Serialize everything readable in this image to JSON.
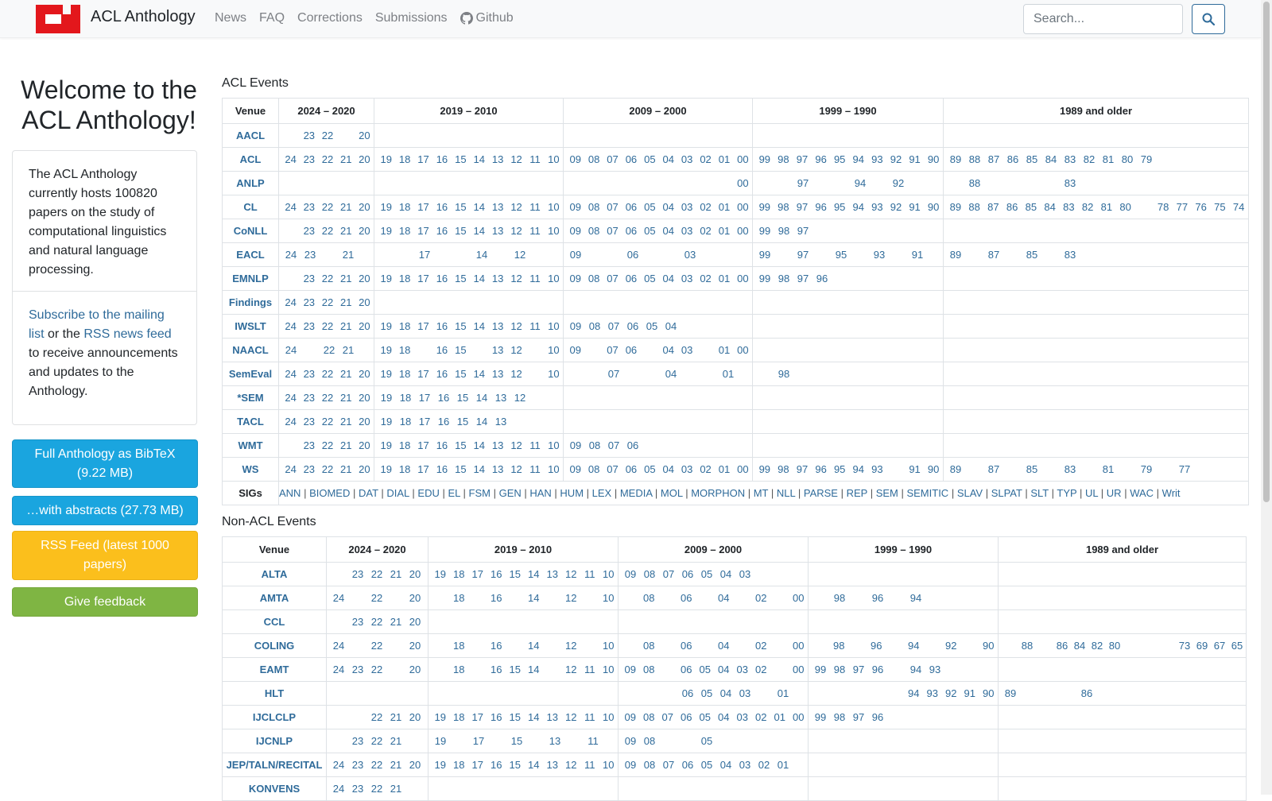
{
  "navbar": {
    "brand": "ACL Anthology",
    "links": [
      "News",
      "FAQ",
      "Corrections",
      "Submissions",
      "Github"
    ],
    "search_placeholder": "Search..."
  },
  "sidebar": {
    "welcome": "Welcome to the ACL Anthology!",
    "intro": "The ACL Anthology currently hosts 100820 papers on the study of computational linguistics and natural language processing.",
    "subscribe_link": "Subscribe to the mailing list",
    "or_the": " or the ",
    "rss_link": "RSS news feed",
    "subscribe_rest": " to receive announcements and updates to the Anthology.",
    "btn_bibtex": "Full Anthology as BibTeX (9.22 MB)",
    "btn_abstracts": "…with abstracts (27.73 MB)",
    "btn_rss": "RSS Feed (latest 1000 papers)",
    "btn_feedback": "Give feedback"
  },
  "acl_events": {
    "title": "ACL Events",
    "headers": [
      "Venue",
      "2024 – 2020",
      "2019 – 2010",
      "2009 – 2000",
      "1999 – 1990",
      "1989 and older"
    ],
    "rows": [
      {
        "venue": "AACL",
        "years": [
          [
            "",
            "23",
            "22",
            "",
            "20"
          ],
          [],
          [],
          [],
          []
        ]
      },
      {
        "venue": "ACL",
        "years": [
          [
            "24",
            "23",
            "22",
            "21",
            "20"
          ],
          [
            "19",
            "18",
            "17",
            "16",
            "15",
            "14",
            "13",
            "12",
            "11",
            "10"
          ],
          [
            "09",
            "08",
            "07",
            "06",
            "05",
            "04",
            "03",
            "02",
            "01",
            "00"
          ],
          [
            "99",
            "98",
            "97",
            "96",
            "95",
            "94",
            "93",
            "92",
            "91",
            "90"
          ],
          [
            "89",
            "88",
            "87",
            "86",
            "85",
            "84",
            "83",
            "82",
            "81",
            "80",
            "79"
          ]
        ]
      },
      {
        "venue": "ANLP",
        "years": [
          [],
          [],
          [
            "",
            "",
            "",
            "",
            "",
            "",
            "",
            "",
            "",
            "00"
          ],
          [
            "",
            "",
            "97",
            "",
            "",
            "94",
            "",
            "92"
          ],
          [
            "",
            "88",
            "",
            "",
            "",
            "",
            "83"
          ]
        ]
      },
      {
        "venue": "CL",
        "years": [
          [
            "24",
            "23",
            "22",
            "21",
            "20"
          ],
          [
            "19",
            "18",
            "17",
            "16",
            "15",
            "14",
            "13",
            "12",
            "11",
            "10"
          ],
          [
            "09",
            "08",
            "07",
            "06",
            "05",
            "04",
            "03",
            "02",
            "01",
            "00"
          ],
          [
            "99",
            "98",
            "97",
            "96",
            "95",
            "94",
            "93",
            "92",
            "91",
            "90"
          ],
          [
            "89",
            "88",
            "87",
            "86",
            "85",
            "84",
            "83",
            "82",
            "81",
            "80",
            "",
            "78",
            "77",
            "76",
            "75",
            "74"
          ]
        ]
      },
      {
        "venue": "CoNLL",
        "years": [
          [
            "",
            "23",
            "22",
            "21",
            "20"
          ],
          [
            "19",
            "18",
            "17",
            "16",
            "15",
            "14",
            "13",
            "12",
            "11",
            "10"
          ],
          [
            "09",
            "08",
            "07",
            "06",
            "05",
            "04",
            "03",
            "02",
            "01",
            "00"
          ],
          [
            "99",
            "98",
            "97"
          ],
          []
        ]
      },
      {
        "venue": "EACL",
        "years": [
          [
            "24",
            "23",
            "",
            "21"
          ],
          [
            "",
            "",
            "17",
            "",
            "",
            "14",
            "",
            "12"
          ],
          [
            "09",
            "",
            "",
            "06",
            "",
            "",
            "03"
          ],
          [
            "99",
            "",
            "97",
            "",
            "95",
            "",
            "93",
            "",
            "91"
          ],
          [
            "89",
            "",
            "87",
            "",
            "85",
            "",
            "83"
          ]
        ]
      },
      {
        "venue": "EMNLP",
        "years": [
          [
            "",
            "23",
            "22",
            "21",
            "20"
          ],
          [
            "19",
            "18",
            "17",
            "16",
            "15",
            "14",
            "13",
            "12",
            "11",
            "10"
          ],
          [
            "09",
            "08",
            "07",
            "06",
            "05",
            "04",
            "03",
            "02",
            "01",
            "00"
          ],
          [
            "99",
            "98",
            "97",
            "96"
          ],
          []
        ]
      },
      {
        "venue": "Findings",
        "years": [
          [
            "24",
            "23",
            "22",
            "21",
            "20"
          ],
          [],
          [],
          [],
          []
        ]
      },
      {
        "venue": "IWSLT",
        "years": [
          [
            "24",
            "23",
            "22",
            "21",
            "20"
          ],
          [
            "19",
            "18",
            "17",
            "16",
            "15",
            "14",
            "13",
            "12",
            "11",
            "10"
          ],
          [
            "09",
            "08",
            "07",
            "06",
            "05",
            "04"
          ],
          [],
          []
        ]
      },
      {
        "venue": "NAACL",
        "years": [
          [
            "24",
            "",
            "22",
            "21"
          ],
          [
            "19",
            "18",
            "",
            "16",
            "15",
            "",
            "13",
            "12",
            "",
            "10"
          ],
          [
            "09",
            "",
            "07",
            "06",
            "",
            "04",
            "03",
            "",
            "01",
            "00"
          ],
          [],
          []
        ]
      },
      {
        "venue": "SemEval",
        "years": [
          [
            "24",
            "23",
            "22",
            "21",
            "20"
          ],
          [
            "19",
            "18",
            "17",
            "16",
            "15",
            "14",
            "13",
            "12",
            "",
            "10"
          ],
          [
            "",
            "",
            "07",
            "",
            "",
            "04",
            "",
            "",
            "01"
          ],
          [
            "",
            "98"
          ],
          []
        ]
      },
      {
        "venue": "*SEM",
        "years": [
          [
            "24",
            "23",
            "22",
            "21",
            "20"
          ],
          [
            "19",
            "18",
            "17",
            "16",
            "15",
            "14",
            "13",
            "12"
          ],
          [],
          [],
          []
        ]
      },
      {
        "venue": "TACL",
        "years": [
          [
            "24",
            "23",
            "22",
            "21",
            "20"
          ],
          [
            "19",
            "18",
            "17",
            "16",
            "15",
            "14",
            "13"
          ],
          [],
          [],
          []
        ]
      },
      {
        "venue": "WMT",
        "years": [
          [
            "",
            "23",
            "22",
            "21",
            "20"
          ],
          [
            "19",
            "18",
            "17",
            "16",
            "15",
            "14",
            "13",
            "12",
            "11",
            "10"
          ],
          [
            "09",
            "08",
            "07",
            "06"
          ],
          [],
          []
        ]
      },
      {
        "venue": "WS",
        "years": [
          [
            "24",
            "23",
            "22",
            "21",
            "20"
          ],
          [
            "19",
            "18",
            "17",
            "16",
            "15",
            "14",
            "13",
            "12",
            "11",
            "10"
          ],
          [
            "09",
            "08",
            "07",
            "06",
            "05",
            "04",
            "03",
            "02",
            "01",
            "00"
          ],
          [
            "99",
            "98",
            "97",
            "96",
            "95",
            "94",
            "93",
            "",
            "91",
            "90"
          ],
          [
            "89",
            "",
            "87",
            "",
            "85",
            "",
            "83",
            "",
            "81",
            "",
            "79",
            "",
            "77"
          ]
        ]
      }
    ],
    "sigs_label": "SIGs",
    "sigs": [
      "ANN",
      "BIOMED",
      "DAT",
      "DIAL",
      "EDU",
      "EL",
      "FSM",
      "GEN",
      "HAN",
      "HUM",
      "LEX",
      "MEDIA",
      "MOL",
      "MORPHON",
      "MT",
      "NLL",
      "PARSE",
      "REP",
      "SEM",
      "SEMITIC",
      "SLAV",
      "SLPAT",
      "SLT",
      "TYP",
      "UL",
      "UR",
      "WAC",
      "Writ"
    ]
  },
  "non_acl_events": {
    "title": "Non-ACL Events",
    "headers": [
      "Venue",
      "2024 – 2020",
      "2019 – 2010",
      "2009 – 2000",
      "1999 – 1990",
      "1989 and older"
    ],
    "rows": [
      {
        "venue": "ALTA",
        "years": [
          [
            "",
            "23",
            "22",
            "21",
            "20"
          ],
          [
            "19",
            "18",
            "17",
            "16",
            "15",
            "14",
            "13",
            "12",
            "11",
            "10"
          ],
          [
            "09",
            "08",
            "07",
            "06",
            "05",
            "04",
            "03"
          ],
          [],
          []
        ]
      },
      {
        "venue": "AMTA",
        "years": [
          [
            "24",
            "",
            "22",
            "",
            "20"
          ],
          [
            "",
            "18",
            "",
            "16",
            "",
            "14",
            "",
            "12",
            "",
            "10"
          ],
          [
            "",
            "08",
            "",
            "06",
            "",
            "04",
            "",
            "02",
            "",
            "00"
          ],
          [
            "",
            "98",
            "",
            "96",
            "",
            "94"
          ],
          []
        ]
      },
      {
        "venue": "CCL",
        "years": [
          [
            "",
            "23",
            "22",
            "21",
            "20"
          ],
          [],
          [],
          [],
          []
        ]
      },
      {
        "venue": "COLING",
        "years": [
          [
            "24",
            "",
            "22",
            "",
            "20"
          ],
          [
            "",
            "18",
            "",
            "16",
            "",
            "14",
            "",
            "12",
            "",
            "10"
          ],
          [
            "",
            "08",
            "",
            "06",
            "",
            "04",
            "",
            "02",
            "",
            "00"
          ],
          [
            "",
            "98",
            "",
            "96",
            "",
            "94",
            "",
            "92",
            "",
            "90"
          ],
          [
            "",
            "88",
            "",
            "86",
            "84",
            "82",
            "80",
            "",
            "",
            "",
            "73",
            "69",
            "67",
            "65"
          ]
        ]
      },
      {
        "venue": "EAMT",
        "years": [
          [
            "24",
            "23",
            "22",
            "",
            "20"
          ],
          [
            "",
            "18",
            "",
            "16",
            "15",
            "14",
            "",
            "12",
            "11",
            "10"
          ],
          [
            "09",
            "08",
            "",
            "06",
            "05",
            "04",
            "03",
            "02",
            "",
            "00"
          ],
          [
            "99",
            "98",
            "97",
            "96",
            "",
            "94",
            "93"
          ],
          []
        ]
      },
      {
        "venue": "HLT",
        "years": [
          [],
          [],
          [
            "",
            "",
            "",
            "06",
            "05",
            "04",
            "03",
            "",
            "01"
          ],
          [
            "",
            "",
            "",
            "",
            "",
            "94",
            "93",
            "92",
            "91",
            "90"
          ],
          [
            "89",
            "",
            "",
            "",
            "86"
          ]
        ]
      },
      {
        "venue": "IJCLCLP",
        "years": [
          [
            "",
            "",
            "22",
            "21",
            "20"
          ],
          [
            "19",
            "18",
            "17",
            "16",
            "15",
            "14",
            "13",
            "12",
            "11",
            "10"
          ],
          [
            "09",
            "08",
            "07",
            "06",
            "05",
            "04",
            "03",
            "02",
            "01",
            "00"
          ],
          [
            "99",
            "98",
            "97",
            "96"
          ],
          []
        ]
      },
      {
        "venue": "IJCNLP",
        "years": [
          [
            "",
            "23",
            "22",
            "21"
          ],
          [
            "19",
            "",
            "17",
            "",
            "15",
            "",
            "13",
            "",
            "11"
          ],
          [
            "09",
            "08",
            "",
            "",
            "05"
          ],
          [],
          []
        ]
      },
      {
        "venue": "JEP/TALN/RECITAL",
        "years": [
          [
            "24",
            "23",
            "22",
            "21",
            "20"
          ],
          [
            "19",
            "18",
            "17",
            "16",
            "15",
            "14",
            "13",
            "12",
            "11",
            "10"
          ],
          [
            "09",
            "08",
            "07",
            "06",
            "05",
            "04",
            "03",
            "02",
            "01"
          ],
          [],
          []
        ]
      },
      {
        "venue": "KONVENS",
        "years": [
          [
            "24",
            "23",
            "22",
            "21"
          ],
          [],
          [],
          [],
          []
        ]
      }
    ]
  },
  "colors": {
    "link": "#2f6b9a",
    "logo_red": "#e3171c",
    "btn_blue": "#1aa5df",
    "btn_yellow": "#fbbf1c",
    "btn_green": "#7fb543"
  }
}
